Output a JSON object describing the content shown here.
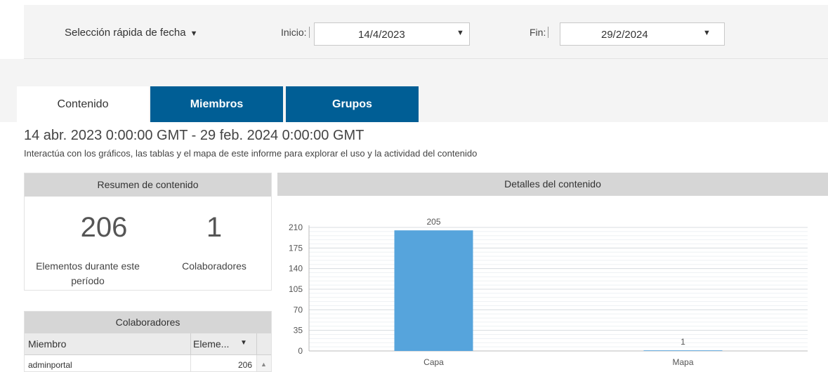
{
  "filter": {
    "quick_select_label": "Selección rápida de fecha",
    "start_label": "Inicio:",
    "start_value": "14/4/2023",
    "end_label": "Fin:",
    "end_value": "29/2/2024"
  },
  "tabs": [
    {
      "label": "Contenido",
      "active": true
    },
    {
      "label": "Miembros",
      "active": false
    },
    {
      "label": "Grupos",
      "active": false
    }
  ],
  "report": {
    "range_text": "14 abr. 2023 0:00:00 GMT - 29 feb. 2024 0:00:00 GMT",
    "subtitle": "Interactúa con los gráficos, las tablas y el mapa de este informe para explorar el uso y la actividad del contenido"
  },
  "summary": {
    "title": "Resumen de contenido",
    "items_value": "206",
    "items_label": "Elementos durante este período",
    "collaborators_value": "1",
    "collaborators_label": "Colaboradores"
  },
  "collaborators": {
    "title": "Colaboradores",
    "col_member": "Miembro",
    "col_items": "Eleme...",
    "rows": [
      {
        "member": "adminportal",
        "items": "206"
      }
    ]
  },
  "details": {
    "title": "Detalles del contenido"
  },
  "colors": {
    "tab_blue": "#005e95",
    "bar_blue": "#56a4dc",
    "panel_header": "#d6d6d6"
  },
  "chart_data": {
    "type": "bar",
    "categories": [
      "Capa",
      "Mapa"
    ],
    "values": [
      205,
      1
    ],
    "ylim": [
      0,
      210
    ],
    "yticks": [
      0,
      35,
      70,
      105,
      140,
      175,
      210
    ],
    "grid": true
  }
}
